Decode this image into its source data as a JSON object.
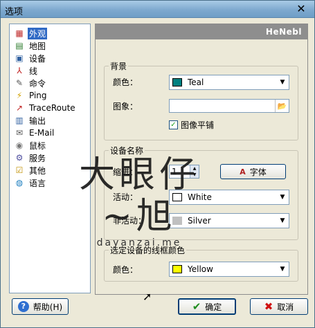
{
  "window": {
    "title": "选项",
    "close_glyph": "✕"
  },
  "nav": {
    "items": [
      {
        "label": "外观",
        "icon": "appearance-icon",
        "selected": true
      },
      {
        "label": "地图",
        "icon": "map-icon",
        "selected": false
      },
      {
        "label": "设备",
        "icon": "device-icon",
        "selected": false
      },
      {
        "label": "线",
        "icon": "line-icon",
        "selected": false
      },
      {
        "label": "命令",
        "icon": "command-icon",
        "selected": false
      },
      {
        "label": "Ping",
        "icon": "ping-icon",
        "selected": false
      },
      {
        "label": "TraceRoute",
        "icon": "traceroute-icon",
        "selected": false
      },
      {
        "label": "输出",
        "icon": "output-icon",
        "selected": false
      },
      {
        "label": "E-Mail",
        "icon": "email-icon",
        "selected": false
      },
      {
        "label": "鼠标",
        "icon": "mouse-icon",
        "selected": false
      },
      {
        "label": "服务",
        "icon": "service-icon",
        "selected": false
      },
      {
        "label": "其他",
        "icon": "other-icon",
        "selected": false
      },
      {
        "label": "语言",
        "icon": "language-icon",
        "selected": false
      }
    ]
  },
  "panel": {
    "banner": "HeNebl",
    "background": {
      "legend": "背景",
      "color_label": "颜色：",
      "color_value": "Teal",
      "color_swatch": "#008080",
      "image_label": "图象：",
      "image_value": "",
      "tile_label": "图像平铺",
      "tile_checked": true
    },
    "device_name": {
      "legend": "设备名称",
      "indent_label": "缩进：",
      "indent_value": "1",
      "font_button": "字体",
      "active_label": "活动：",
      "active_value": "White",
      "active_swatch": "#ffffff",
      "inactive_label": "非活动：",
      "inactive_value": "Silver",
      "inactive_swatch": "#c0c0c0"
    },
    "frame_color": {
      "legend": "选定设备的线框颜色",
      "color_label": "颜色：",
      "color_value": "Yellow",
      "color_swatch": "#ffff00"
    }
  },
  "buttons": {
    "help": "帮助(H)",
    "ok": "确定",
    "cancel": "取消"
  },
  "watermark": {
    "big": "大眼仔~旭",
    "small": "dayanzai.me"
  }
}
